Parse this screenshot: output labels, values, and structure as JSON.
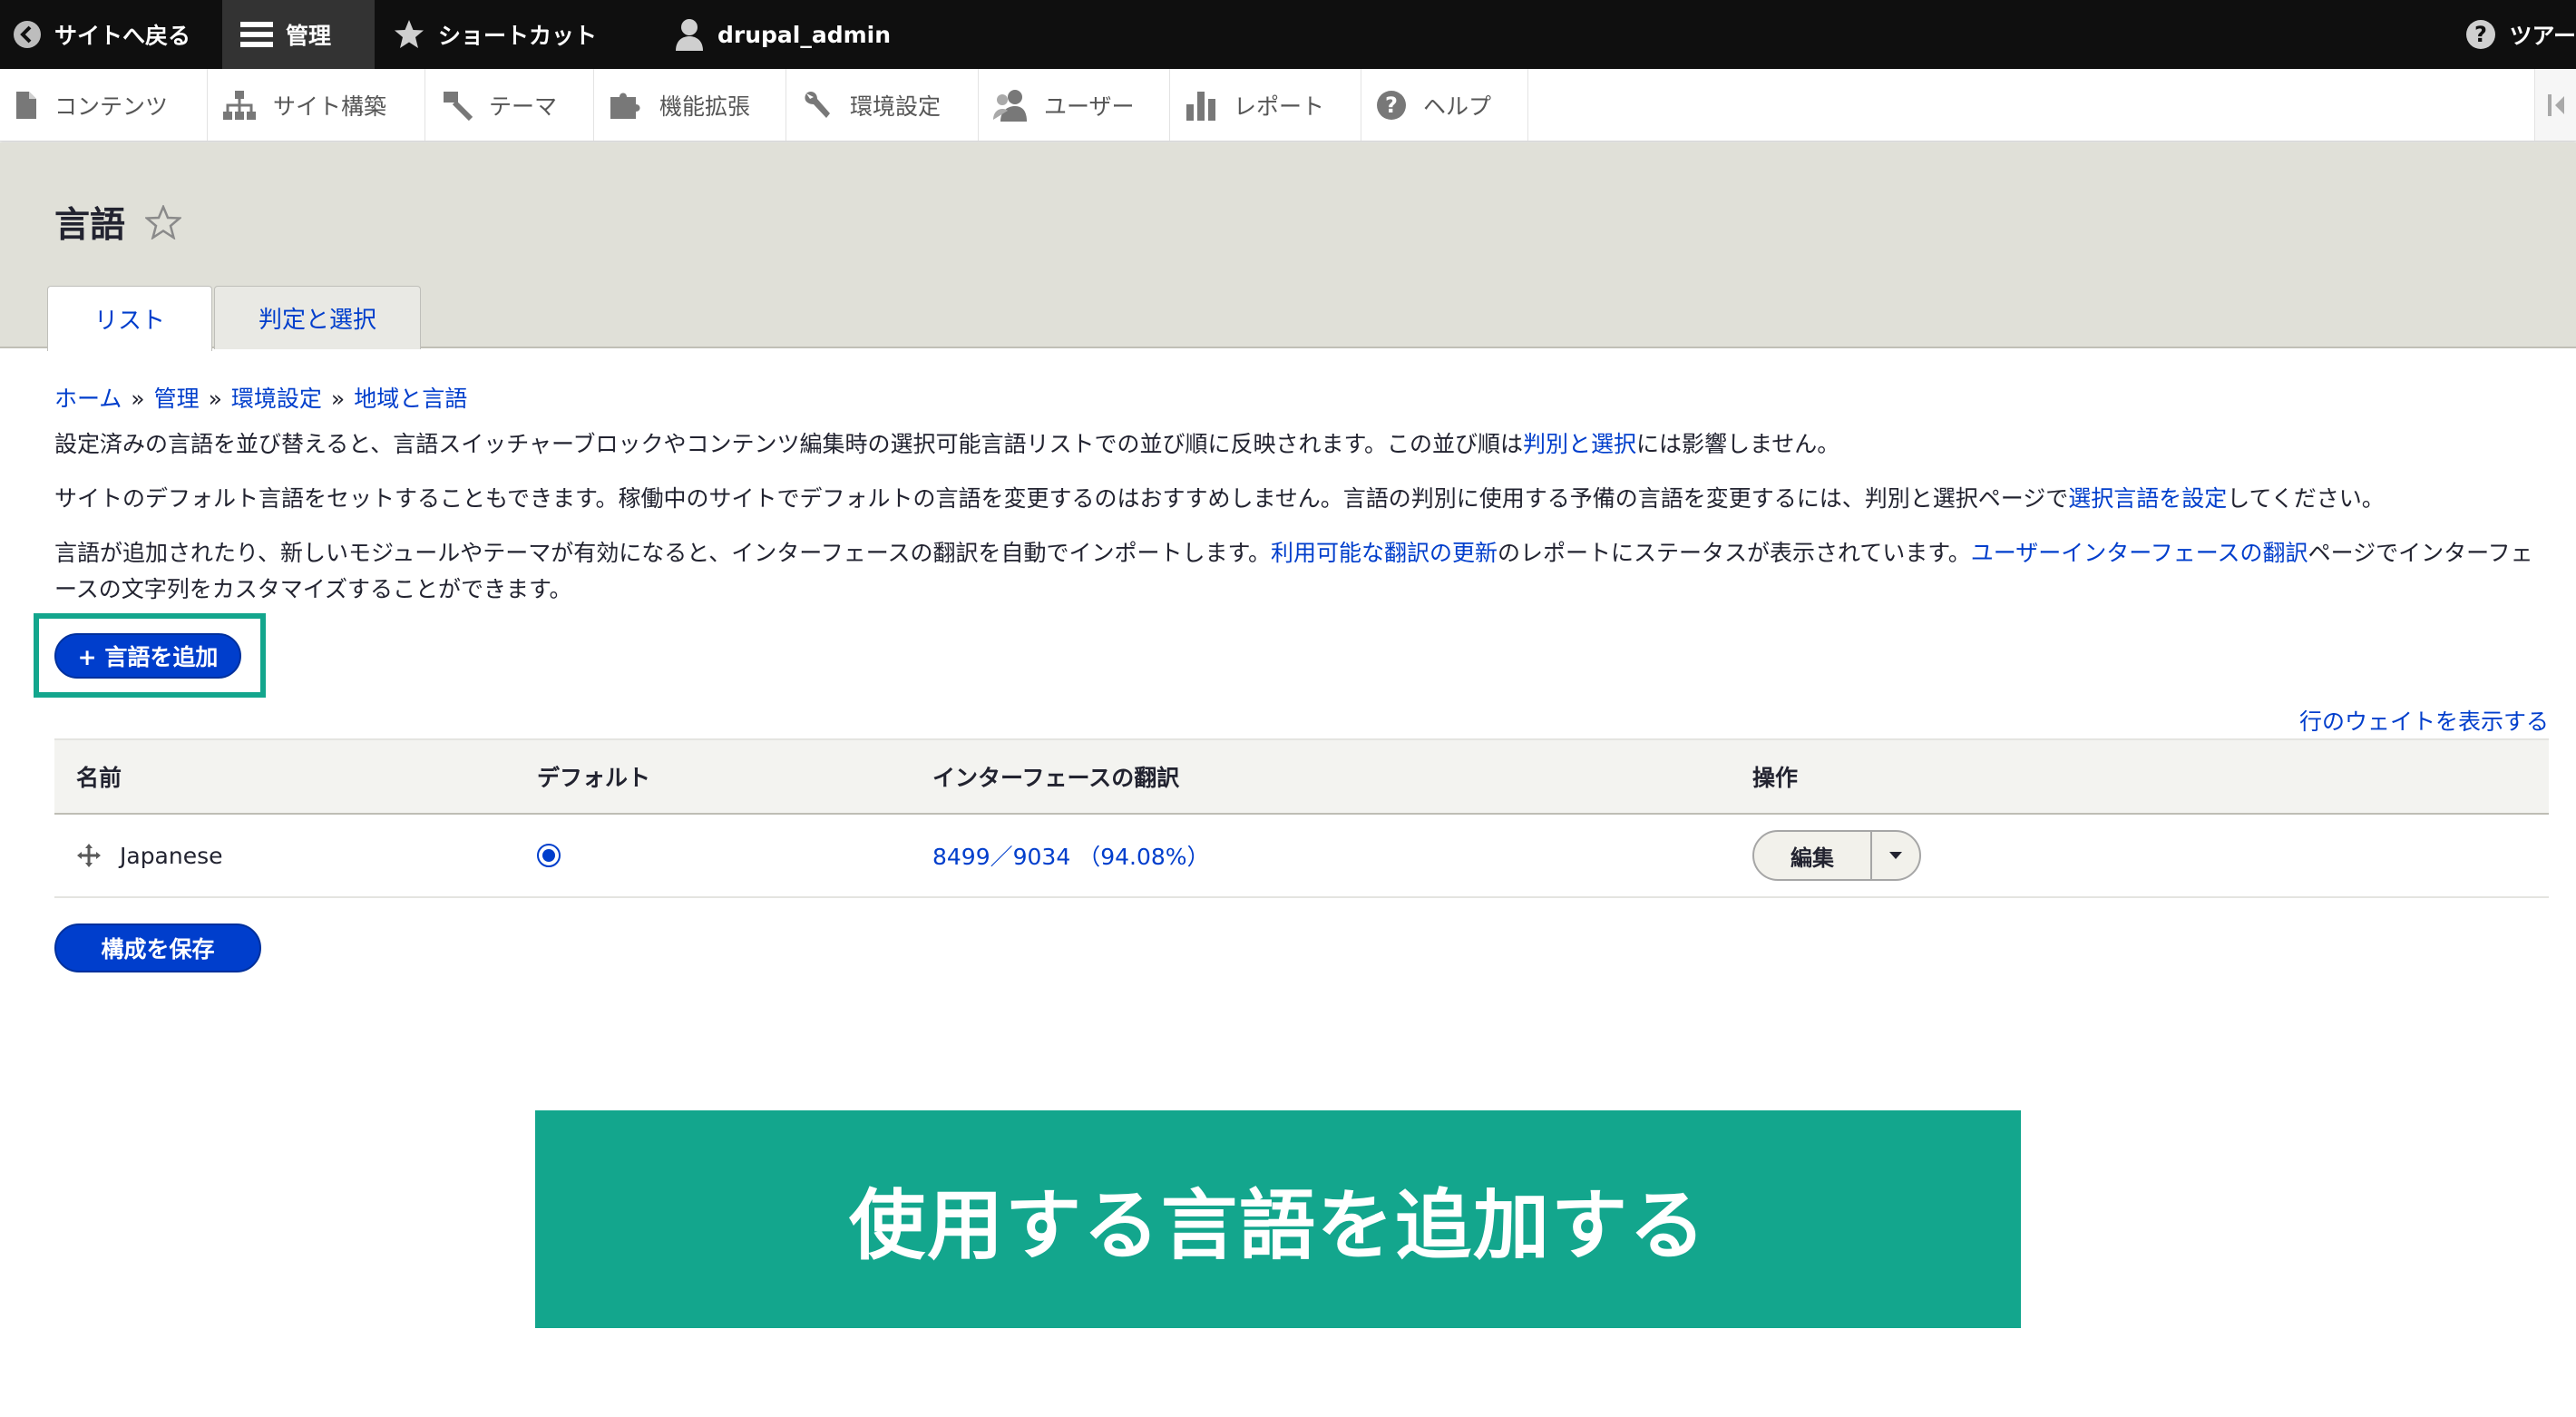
{
  "toolbar": {
    "back_label": "サイトへ戻る",
    "manage_label": "管理",
    "shortcuts_label": "ショートカット",
    "user_label": "drupal_admin",
    "tour_label": "ツアー"
  },
  "tray": {
    "items": [
      {
        "label": "コンテンツ",
        "icon": "file-icon"
      },
      {
        "label": "サイト構築",
        "icon": "sitemap-icon"
      },
      {
        "label": "テーマ",
        "icon": "paintbrush-icon"
      },
      {
        "label": "機能拡張",
        "icon": "puzzle-icon"
      },
      {
        "label": "環境設定",
        "icon": "wrench-icon"
      },
      {
        "label": "ユーザー",
        "icon": "people-icon"
      },
      {
        "label": "レポート",
        "icon": "bar-chart-icon"
      },
      {
        "label": "ヘルプ",
        "icon": "help-icon"
      }
    ]
  },
  "page": {
    "title": "言語",
    "tabs": [
      {
        "label": "リスト",
        "active": true
      },
      {
        "label": "判定と選択",
        "active": false
      }
    ]
  },
  "breadcrumb": {
    "home": "ホーム",
    "admin": "管理",
    "config": "環境設定",
    "region": "地域と言語",
    "separator": "»"
  },
  "description": {
    "p1_text": "設定済みの言語を並び替えると、言語スイッチャーブロックやコンテンツ編集時の選択可能言語リストでの並び順に反映されます。この並び順は",
    "p1_link": "判別と選択",
    "p1_tail": "には影響しません。",
    "p2_text": "サイトのデフォルト言語をセットすることもできます。稼働中のサイトでデフォルトの言語を変更するのはおすすめしません。言語の判別に使用する予備の言語を変更するには、判別と選択ページで",
    "p2_link": "選択言語を設定",
    "p2_tail": "してください。",
    "p3_text": "言語が追加されたり、新しいモジュールやテーマが有効になると、インターフェースの翻訳を自動でインポートします。",
    "p3_link1": "利用可能な翻訳の更新",
    "p3_mid": "のレポートにステータスが表示されています。",
    "p3_link2": "ユーザーインターフェースの翻訳",
    "p3_tail": "ページでインターフェースの文字列をカスタマイズすることができます。"
  },
  "actions": {
    "add_language": "+ 言語を追加",
    "show_weights": "行のウェイトを表示する",
    "save": "構成を保存"
  },
  "table": {
    "headers": {
      "name": "名前",
      "default": "デフォルト",
      "translation": "インターフェースの翻訳",
      "operations": "操作"
    },
    "rows": [
      {
        "name": "Japanese",
        "is_default": true,
        "translation": "8499／9034 （94.08%）",
        "operation": "編集"
      }
    ]
  },
  "banner": {
    "text": "使用する言語を追加する"
  },
  "colors": {
    "link": "#003ecc",
    "banner": "#13a68d",
    "header_bg": "#e0e0d8",
    "toolbar_bg": "#0f0f0f"
  }
}
